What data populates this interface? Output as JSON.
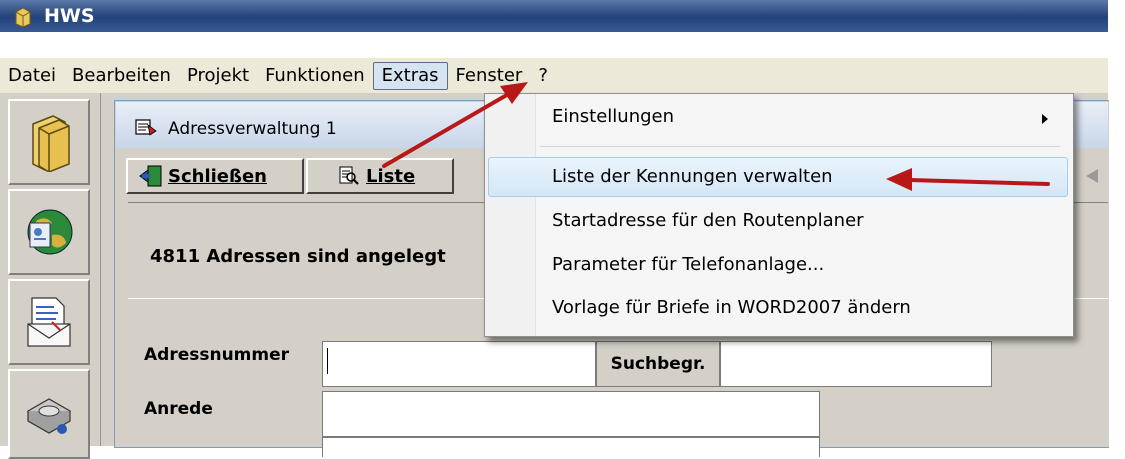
{
  "app": {
    "title": "HWS"
  },
  "menu": {
    "items": [
      "Datei",
      "Bearbeiten",
      "Projekt",
      "Funktionen",
      "Extras",
      "Fenster",
      "?"
    ],
    "selected": "Extras"
  },
  "window": {
    "title": "Adressverwaltung 1"
  },
  "toolbar": {
    "close_label": "Schließen",
    "list_label": "Liste"
  },
  "content": {
    "address_count": "4811 Adressen sind angelegt"
  },
  "form": {
    "address_number_label": "Adressnummer",
    "address_number_value": "",
    "search_label": "Suchbegr.",
    "salutation_label": "Anrede"
  },
  "extras_menu": {
    "items": [
      {
        "label": "Einstellungen",
        "submenu": true
      },
      {
        "label": "Liste der Kennungen verwalten",
        "highlighted": true
      },
      {
        "label": "Startadresse für den Routenplaner"
      },
      {
        "label": "Parameter für Telefonanlage..."
      },
      {
        "label": "Vorlage für Briefe in WORD2007 ändern"
      }
    ]
  },
  "colors": {
    "title_bar": "#2c4a80",
    "annotation_arrow": "#c81e1e",
    "highlight": "#d3e6f6"
  }
}
